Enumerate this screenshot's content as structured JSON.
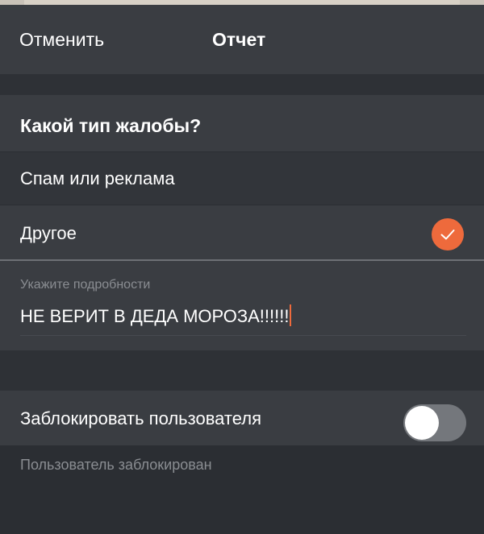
{
  "header": {
    "cancel_label": "Отменить",
    "title": "Отчет"
  },
  "report": {
    "question": "Какой тип жалобы?",
    "options": [
      {
        "label": "Спам или реклама",
        "selected": false
      },
      {
        "label": "Другое",
        "selected": true
      }
    ]
  },
  "details": {
    "placeholder": "Укажите подробности",
    "value": "НЕ ВЕРИТ В ДЕДА МОРОЗА!!!!!!"
  },
  "block": {
    "label": "Заблокировать пользователя",
    "enabled": false,
    "note": "Пользователь заблокирован"
  },
  "colors": {
    "accent": "#ee6a3c",
    "row_background": "#3a3d42",
    "page_background": "#2b2e33"
  }
}
